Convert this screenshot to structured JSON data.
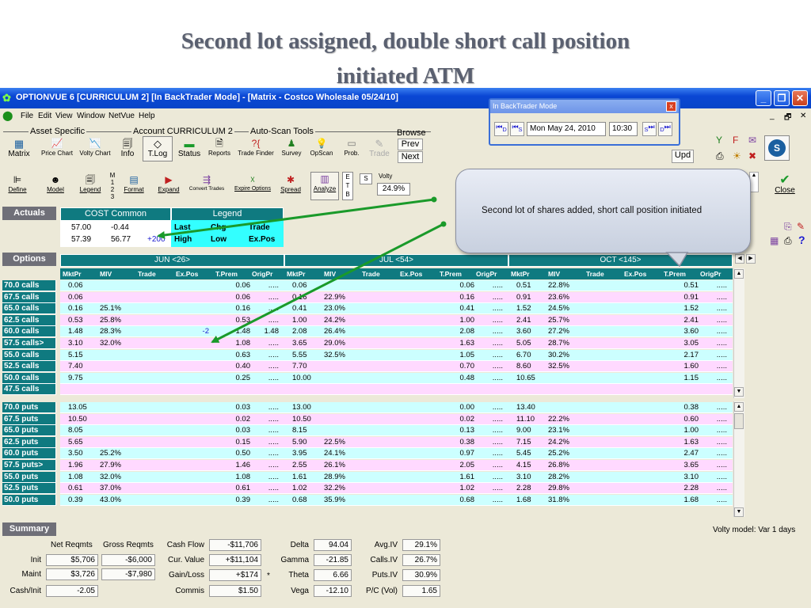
{
  "slide": {
    "title_line1": "Second lot assigned, double short call position",
    "title_line2": "initiated ATM"
  },
  "window": {
    "title": "OPTIONVUE 6   [CURRICULUM 2]   [In BackTrader Mode] - [Matrix - Costco Wholesale  05/24/10]",
    "minimize": "_",
    "restore": "❐",
    "close": "✕",
    "mdi_controls": [
      "_",
      "🗗",
      "✕"
    ]
  },
  "menu": [
    "File",
    "Edit",
    "View",
    "Window",
    "NetVue",
    "Help"
  ],
  "toolbar1": {
    "group_asset": "Asset Specific",
    "group_account": "Account CURRICULUM 2",
    "group_autoscan": "Auto-Scan Tools",
    "browse": "Browse",
    "prev": "Prev",
    "next": "Next",
    "upd": "Upd",
    "buttons": [
      "Matrix",
      "Price Chart",
      "Volty Chart",
      "Info",
      "T.Log",
      "Status",
      "Reports",
      "Trade Finder",
      "Survey",
      "OpScan",
      "Prob.",
      "Trade"
    ]
  },
  "toolbar2": {
    "buttons": [
      "Define",
      "Model",
      "Legend",
      "Format",
      "Expand",
      "Convert Trades",
      "Expire Options",
      "Spread",
      "Analyze"
    ],
    "m123": [
      "M",
      "1",
      "2",
      "3"
    ],
    "etb": [
      "E",
      "T",
      "B"
    ],
    "s": "S",
    "volty_label": "Volty",
    "volty_value": "24.9%",
    "close": "Close"
  },
  "backtrader": {
    "title": "In BackTrader Mode",
    "close": "x",
    "btn_d": "D",
    "btn_s": "S",
    "date": "Mon May 24, 2010",
    "time": "10:30",
    "btn_s2": "S",
    "btn_d2": "D"
  },
  "callout": "Second lot of shares added, short call position initiated",
  "actuals": {
    "label": "Actuals",
    "stock": "COST Common",
    "legend_title": "Legend",
    "r1": [
      "57.00",
      "-0.44"
    ],
    "r2": [
      "57.39",
      "56.77",
      "+200"
    ],
    "legend_row1": [
      "Last",
      "Chg",
      "Trade"
    ],
    "legend_row2": [
      "High",
      "Low",
      "Ex.Pos"
    ]
  },
  "options": {
    "label": "Options",
    "months": [
      "JUN <26>",
      "JUL <54>",
      "OCT <145>"
    ],
    "cols": [
      "MktPr",
      "MIV",
      "Trade",
      "Ex.Pos",
      "T.Prem",
      "OrigPr"
    ],
    "calls": [
      {
        "label": "70.0 calls",
        "jun": [
          "0.06",
          "",
          "",
          "",
          "0.06",
          "....."
        ],
        "jul": [
          "0.06",
          "",
          "",
          "",
          "0.06",
          "....."
        ],
        "oct": [
          "0.51",
          "22.8%",
          "",
          "",
          "0.51",
          "....."
        ]
      },
      {
        "label": "67.5 calls",
        "jun": [
          "0.06",
          "",
          "",
          "",
          "0.06",
          "....."
        ],
        "jul": [
          "0.16",
          "22.9%",
          "",
          "",
          "0.16",
          "....."
        ],
        "oct": [
          "0.91",
          "23.6%",
          "",
          "",
          "0.91",
          "....."
        ]
      },
      {
        "label": "65.0 calls",
        "jun": [
          "0.16",
          "25.1%",
          "",
          "",
          "0.16",
          "....."
        ],
        "jul": [
          "0.41",
          "23.0%",
          "",
          "",
          "0.41",
          "....."
        ],
        "oct": [
          "1.52",
          "24.5%",
          "",
          "",
          "1.52",
          "....."
        ]
      },
      {
        "label": "62.5 calls",
        "jun": [
          "0.53",
          "25.8%",
          "",
          "",
          "0.53",
          "....."
        ],
        "jul": [
          "1.00",
          "24.2%",
          "",
          "",
          "1.00",
          "....."
        ],
        "oct": [
          "2.41",
          "25.7%",
          "",
          "",
          "2.41",
          "....."
        ]
      },
      {
        "label": "60.0 calls",
        "jun": [
          "1.48",
          "28.3%",
          "",
          "-2",
          "1.48",
          "1.48"
        ],
        "jul": [
          "2.08",
          "26.4%",
          "",
          "",
          "2.08",
          "....."
        ],
        "oct": [
          "3.60",
          "27.2%",
          "",
          "",
          "3.60",
          "....."
        ]
      },
      {
        "label": "57.5 calls>",
        "jun": [
          "3.10",
          "32.0%",
          "",
          "",
          "1.08",
          "....."
        ],
        "jul": [
          "3.65",
          "29.0%",
          "",
          "",
          "1.63",
          "....."
        ],
        "oct": [
          "5.05",
          "28.7%",
          "",
          "",
          "3.05",
          "....."
        ]
      },
      {
        "label": "55.0 calls",
        "jun": [
          "5.15",
          "",
          "",
          "",
          "0.63",
          "....."
        ],
        "jul": [
          "5.55",
          "32.5%",
          "",
          "",
          "1.05",
          "....."
        ],
        "oct": [
          "6.70",
          "30.2%",
          "",
          "",
          "2.17",
          "....."
        ]
      },
      {
        "label": "52.5 calls",
        "jun": [
          "7.40",
          "",
          "",
          "",
          "0.40",
          "....."
        ],
        "jul": [
          "7.70",
          "",
          "",
          "",
          "0.70",
          "....."
        ],
        "oct": [
          "8.60",
          "32.5%",
          "",
          "",
          "1.60",
          "....."
        ]
      },
      {
        "label": "50.0 calls",
        "jun": [
          "9.75",
          "",
          "",
          "",
          "0.25",
          "....."
        ],
        "jul": [
          "10.00",
          "",
          "",
          "",
          "0.48",
          "....."
        ],
        "oct": [
          "10.65",
          "",
          "",
          "",
          "1.15",
          "....."
        ]
      },
      {
        "label": "47.5 calls",
        "jun": [
          "",
          "",
          "",
          "",
          "",
          ""
        ],
        "jul": [
          "",
          "",
          "",
          "",
          "",
          ""
        ],
        "oct": [
          "",
          "",
          "",
          "",
          "",
          ""
        ]
      }
    ],
    "puts": [
      {
        "label": "70.0 puts",
        "jun": [
          "13.05",
          "",
          "",
          "",
          "0.03",
          "....."
        ],
        "jul": [
          "13.00",
          "",
          "",
          "",
          "0.00",
          "....."
        ],
        "oct": [
          "13.40",
          "",
          "",
          "",
          "0.38",
          "....."
        ]
      },
      {
        "label": "67.5 puts",
        "jun": [
          "10.50",
          "",
          "",
          "",
          "0.02",
          "....."
        ],
        "jul": [
          "10.50",
          "",
          "",
          "",
          "0.02",
          "....."
        ],
        "oct": [
          "11.10",
          "22.2%",
          "",
          "",
          "0.60",
          "....."
        ]
      },
      {
        "label": "65.0 puts",
        "jun": [
          "8.05",
          "",
          "",
          "",
          "0.03",
          "....."
        ],
        "jul": [
          "8.15",
          "",
          "",
          "",
          "0.13",
          "....."
        ],
        "oct": [
          "9.00",
          "23.1%",
          "",
          "",
          "1.00",
          "....."
        ]
      },
      {
        "label": "62.5 puts",
        "jun": [
          "5.65",
          "",
          "",
          "",
          "0.15",
          "....."
        ],
        "jul": [
          "5.90",
          "22.5%",
          "",
          "",
          "0.38",
          "....."
        ],
        "oct": [
          "7.15",
          "24.2%",
          "",
          "",
          "1.63",
          "....."
        ]
      },
      {
        "label": "60.0 puts",
        "jun": [
          "3.50",
          "25.2%",
          "",
          "",
          "0.50",
          "....."
        ],
        "jul": [
          "3.95",
          "24.1%",
          "",
          "",
          "0.97",
          "....."
        ],
        "oct": [
          "5.45",
          "25.2%",
          "",
          "",
          "2.47",
          "....."
        ]
      },
      {
        "label": "57.5 puts>",
        "jun": [
          "1.96",
          "27.9%",
          "",
          "",
          "1.46",
          "....."
        ],
        "jul": [
          "2.55",
          "26.1%",
          "",
          "",
          "2.05",
          "....."
        ],
        "oct": [
          "4.15",
          "26.8%",
          "",
          "",
          "3.65",
          "....."
        ]
      },
      {
        "label": "55.0 puts",
        "jun": [
          "1.08",
          "32.0%",
          "",
          "",
          "1.08",
          "....."
        ],
        "jul": [
          "1.61",
          "28.9%",
          "",
          "",
          "1.61",
          "....."
        ],
        "oct": [
          "3.10",
          "28.2%",
          "",
          "",
          "3.10",
          "....."
        ]
      },
      {
        "label": "52.5 puts",
        "jun": [
          "0.61",
          "37.0%",
          "",
          "",
          "0.61",
          "....."
        ],
        "jul": [
          "1.02",
          "32.2%",
          "",
          "",
          "1.02",
          "....."
        ],
        "oct": [
          "2.28",
          "29.8%",
          "",
          "",
          "2.28",
          "....."
        ]
      },
      {
        "label": "50.0 puts",
        "jun": [
          "0.39",
          "43.0%",
          "",
          "",
          "0.39",
          "....."
        ],
        "jul": [
          "0.68",
          "35.9%",
          "",
          "",
          "0.68",
          "....."
        ],
        "oct": [
          "1.68",
          "31.8%",
          "",
          "",
          "1.68",
          "....."
        ]
      }
    ]
  },
  "summary": {
    "label": "Summary",
    "volty_model": "Volty model: Var 1 days",
    "net_reqmts": "Net Reqmts",
    "gross_reqmts": "Gross Reqmts",
    "rows": [
      {
        "label": "Init",
        "net": "$5,706",
        "gross": "-$6,000"
      },
      {
        "label": "Maint",
        "net": "$3,726",
        "gross": "-$7,980"
      },
      {
        "label": "Cash/Init",
        "net": "-2.05",
        "gross": ""
      }
    ],
    "pl": [
      {
        "label": "Cash Flow",
        "value": "-$11,706"
      },
      {
        "label": "Cur. Value",
        "value": "+$11,104"
      },
      {
        "label": "Gain/Loss",
        "value": "+$174"
      },
      {
        "label": "Commis",
        "value": "$1.50"
      }
    ],
    "star": "*",
    "greeks": [
      {
        "label": "Delta",
        "value": "94.04"
      },
      {
        "label": "Gamma",
        "value": "-21.85"
      },
      {
        "label": "Theta",
        "value": "6.66"
      },
      {
        "label": "Vega",
        "value": "-12.10"
      }
    ],
    "iv": [
      {
        "label": "Avg.IV",
        "value": "29.1%"
      },
      {
        "label": "Calls.IV",
        "value": "26.7%"
      },
      {
        "label": "Puts.IV",
        "value": "30.9%"
      },
      {
        "label": "P/C (Vol)",
        "value": "1.65"
      }
    ]
  }
}
